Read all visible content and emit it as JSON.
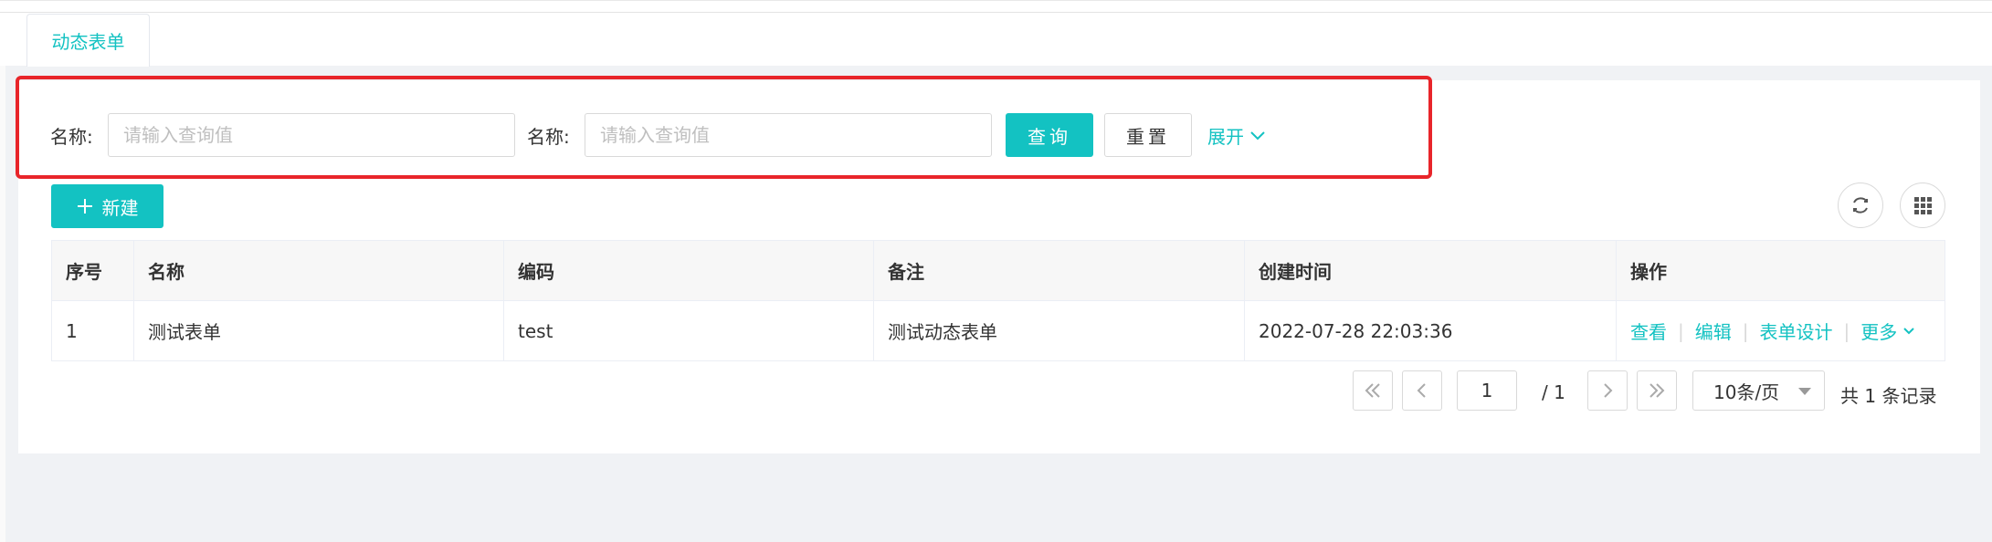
{
  "tabs": [
    {
      "label": "动态表单"
    }
  ],
  "search": {
    "field1_label": "名称:",
    "field1_placeholder": "请输入查询值",
    "field2_label": "名称:",
    "field2_placeholder": "请输入查询值",
    "query_label": "查询",
    "reset_label": "重置",
    "expand_label": "展开"
  },
  "toolbar": {
    "new_label": "新建"
  },
  "table": {
    "columns": [
      "序号",
      "名称",
      "编码",
      "备注",
      "创建时间",
      "操作"
    ],
    "rows": [
      {
        "index": "1",
        "name": "测试表单",
        "code": "test",
        "remark": "测试动态表单",
        "created": "2022-07-28 22:03:36",
        "actions": [
          "查看",
          "编辑",
          "表单设计",
          "更多"
        ]
      }
    ]
  },
  "pagination": {
    "current_page": "1",
    "total_pages": "/ 1",
    "page_size": "10条/页",
    "total_text": "共 1 条记录"
  },
  "colors": {
    "accent": "#13c2c2",
    "highlight": "#e8252a"
  }
}
